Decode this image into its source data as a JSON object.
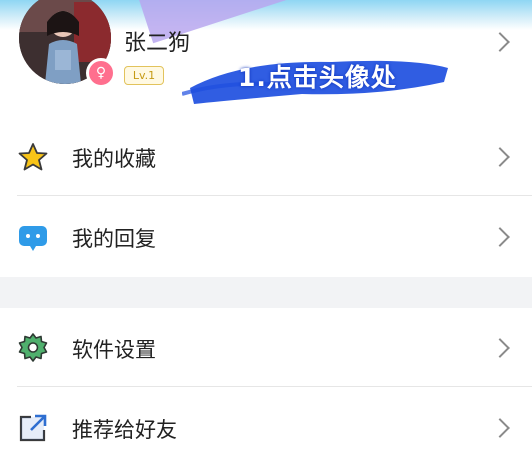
{
  "profile": {
    "username": "张二狗",
    "level": "Lv.1",
    "gender_symbol": "♀"
  },
  "annotation": {
    "text": "1.点击头像处",
    "color": "#1e4fe0"
  },
  "menu": {
    "group1": [
      {
        "label": "我的收藏",
        "icon": "star-icon"
      },
      {
        "label": "我的回复",
        "icon": "chat-bubble-icon"
      }
    ],
    "group2": [
      {
        "label": "软件设置",
        "icon": "gear-icon"
      },
      {
        "label": "推荐给好友",
        "icon": "share-icon"
      }
    ]
  },
  "colors": {
    "star": "#f8c418",
    "chat": "#2f9be8",
    "gear": "#4fb06d",
    "share": "#2f6fd1",
    "level_border": "#e2c35c",
    "gender_badge": "#ff6f8e"
  }
}
